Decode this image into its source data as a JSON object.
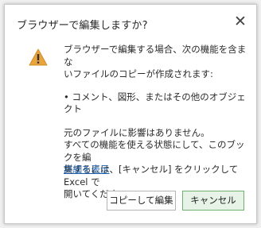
{
  "dialog": {
    "title": "ブラウザーで編集しますか?",
    "close_glyph": "✕",
    "icon": "warning-triangle-icon",
    "message_line1": "ブラウザーで編集する場合、次の機能を含まな",
    "message_line2": "いファイルのコピーが作成されます:",
    "bullet": "• コメント、図形、またはその他のオブジェクト",
    "info_line1": "元のファイルに影響はありません。",
    "info_line2": "すべての機能を使える状態にして、このブックを編",
    "info_line3": "集するには、[キャンセル] をクリックして Excel で",
    "info_line4": "開いてください。",
    "details_link": "詳細を表示",
    "copy_edit_label": "コピーして編集",
    "cancel_label": "キャンセル",
    "colors": {
      "link": "#1a5dab",
      "warning": "#e8a33c",
      "cancel_bg": "#e6f3e6",
      "cancel_border": "#6fb06f"
    }
  }
}
